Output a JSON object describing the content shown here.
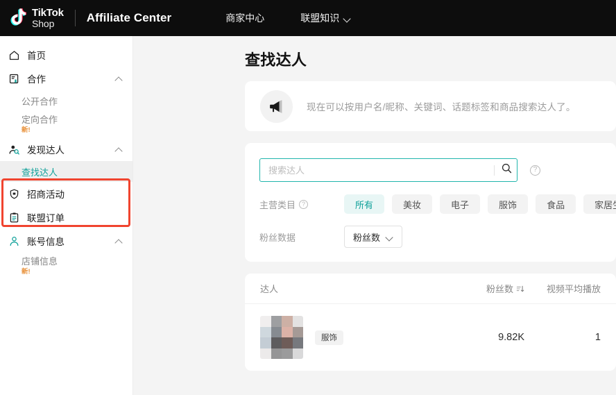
{
  "topbar": {
    "brand_line1": "TikTok",
    "brand_line2": "Shop",
    "product": "Affiliate Center",
    "links": [
      {
        "label": "商家中心",
        "has_caret": false
      },
      {
        "label": "联盟知识",
        "has_caret": true
      }
    ]
  },
  "sidebar": {
    "items": [
      {
        "label": "首页",
        "icon": "home-icon",
        "expandable": false
      },
      {
        "label": "合作",
        "icon": "handshake-icon",
        "expandable": true
      },
      {
        "label": "公开合作",
        "sub": true,
        "badge": ""
      },
      {
        "label": "定向合作",
        "sub": true,
        "badge": "新!"
      },
      {
        "label": "发现达人",
        "icon": "discover-creator-icon",
        "expandable": true,
        "highlighted": true
      },
      {
        "label": "查找达人",
        "sub": true,
        "active": true
      },
      {
        "label": "招商活动",
        "icon": "shield-icon",
        "expandable": false
      },
      {
        "label": "联盟订单",
        "icon": "clipboard-icon",
        "expandable": false
      },
      {
        "label": "账号信息",
        "icon": "user-icon",
        "expandable": true
      },
      {
        "label": "店铺信息",
        "sub": true,
        "badge": "新!"
      }
    ]
  },
  "main": {
    "page_title": "查找达人",
    "announcement": {
      "icon": "megaphone-icon",
      "text": "现在可以按用户名/昵称、关键词、话题标签和商品搜索达人了。"
    },
    "search": {
      "placeholder": "搜索达人",
      "value": "",
      "search_icon": "search-icon",
      "help_icon": "help-icon"
    },
    "filters": {
      "category": {
        "label": "主营类目",
        "help_icon": "help-icon",
        "chips": [
          "所有",
          "美妆",
          "电子",
          "服饰",
          "食品",
          "家居生活"
        ],
        "selected": "所有"
      },
      "fans": {
        "label": "粉丝数据",
        "select_value": "粉丝数"
      }
    },
    "results": {
      "columns": {
        "creator": "达人",
        "fans": "粉丝数",
        "views": "视频平均播放"
      },
      "sort_icon": "sort-icon",
      "rows": [
        {
          "name_redacted": true,
          "tag": "服饰",
          "fans": "9.82K",
          "views": "1"
        }
      ]
    }
  },
  "colors": {
    "accent_teal": "#10a19a",
    "annotation_red": "#f0442f",
    "badge_orange": "#e8913a",
    "topbar_black": "#0d0d0d",
    "page_bg": "#f4f4f4"
  }
}
